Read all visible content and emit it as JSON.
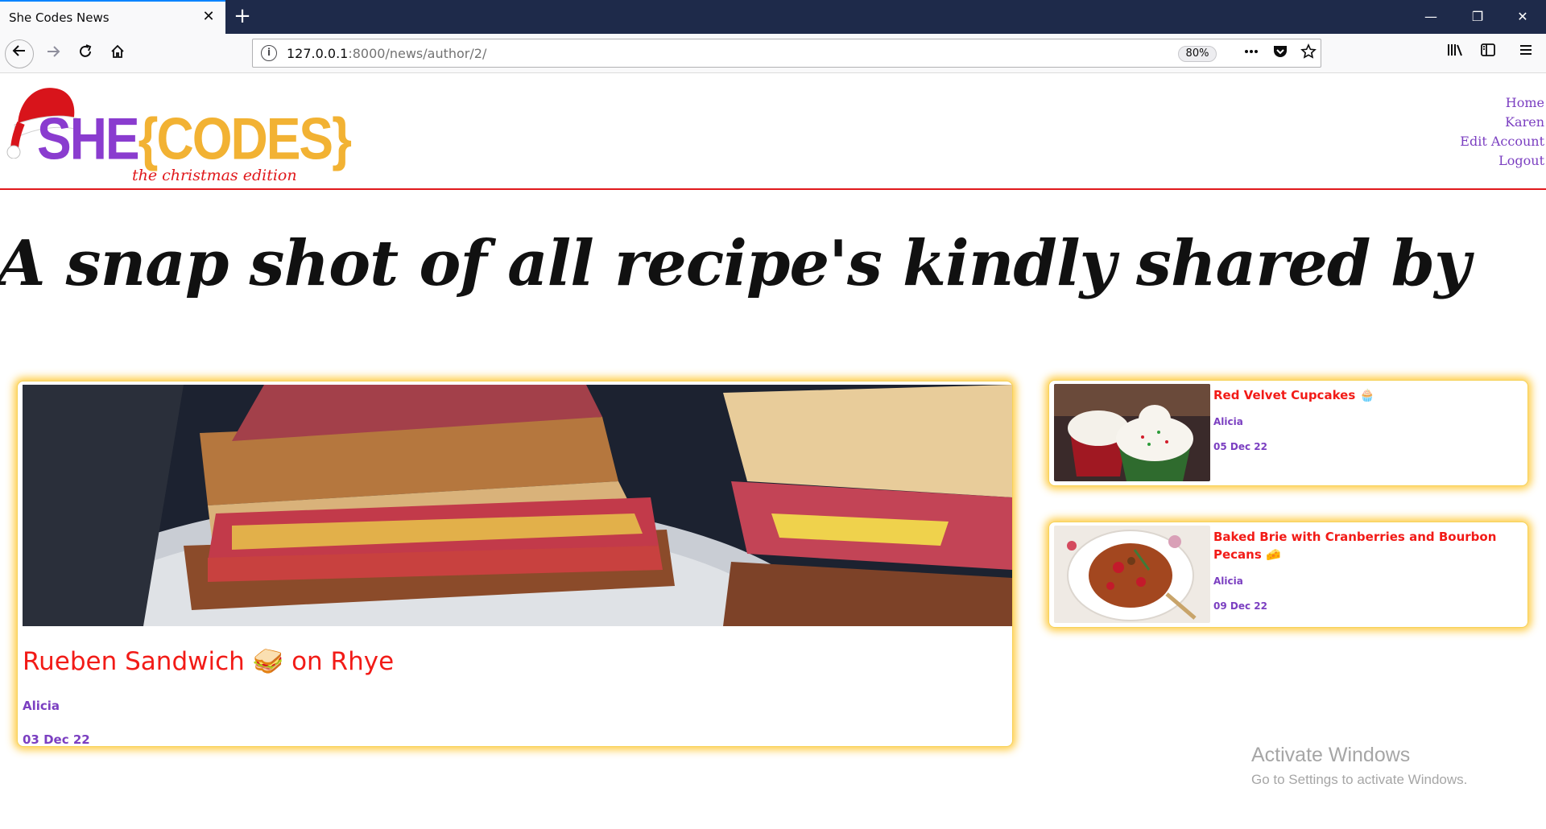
{
  "browser": {
    "tab_title": "She Codes News",
    "tab_close": "✕",
    "new_tab": "+",
    "url_host": "127.0.0.1",
    "url_path": ":8000/news/author/2/",
    "zoom": "80%",
    "window_controls": {
      "minimize": "—",
      "restore": "❐",
      "close": "✕"
    },
    "icons": [
      "back-arrow-icon",
      "forward-arrow-icon",
      "reload-icon",
      "home-icon",
      "info-icon",
      "more-icon",
      "pocket-icon",
      "star-icon",
      "library-icon",
      "sidebar-icon",
      "menu-icon"
    ]
  },
  "site": {
    "logo_she": "SHE",
    "logo_codes": "{CODES}",
    "logo_subtitle": "the christmas edition",
    "nav": [
      "Home",
      "Karen",
      "Edit Account",
      "Logout"
    ]
  },
  "heading": "A snap shot of all recipe's kindly shared by",
  "featured": {
    "title": "Rueben Sandwich 🥪 on Rhye",
    "author": "Alicia",
    "date": "03 Dec 22"
  },
  "stories": [
    {
      "title": "Red Velvet Cupcakes 🧁",
      "author": "Alicia",
      "date": "05 Dec 22"
    },
    {
      "title": "Baked Brie with Cranberries and Bourbon Pecans 🧀",
      "author": "Alicia",
      "date": "09 Dec 22"
    }
  ],
  "watermark": {
    "title": "Activate Windows",
    "subtitle": "Go to Settings to activate Windows."
  },
  "colors": {
    "accent_red": "#f21b17",
    "accent_purple": "#7b3fc1",
    "logo_orange": "#f2b233",
    "card_glow": "#ffc428",
    "tabbar": "#1e2a4a"
  }
}
